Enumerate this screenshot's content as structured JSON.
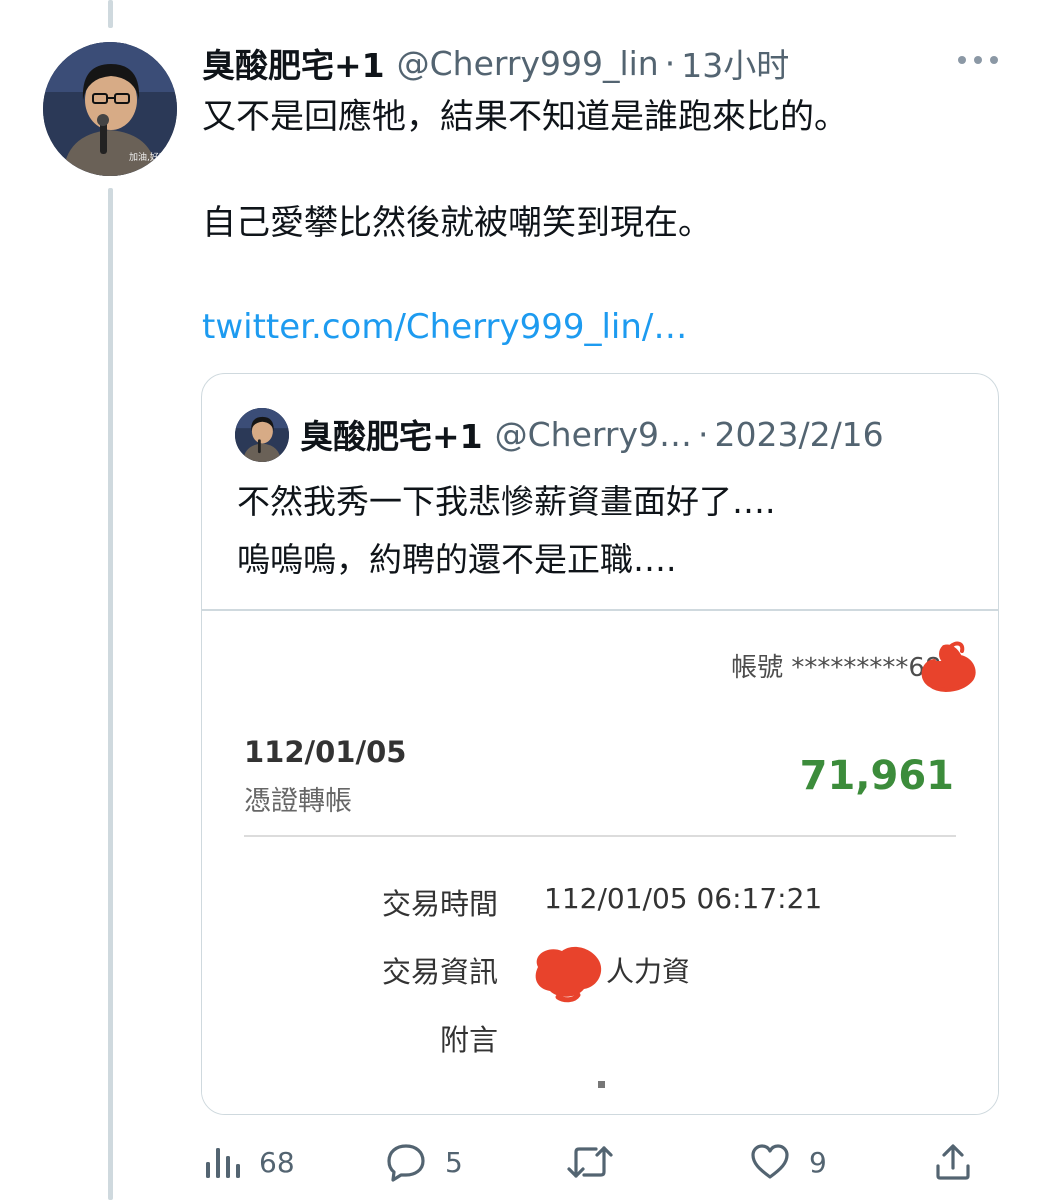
{
  "tweet": {
    "author_name": "臭酸肥宅+1",
    "author_handle": "@Cherry999_lin",
    "separator": "·",
    "time": "13小时",
    "avatar_caption": "加油,好嗎",
    "lines": [
      "又不是回應牠，結果不知道是誰跑來比的。",
      "自己愛攀比然後就被嘲笑到現在。"
    ],
    "link": "twitter.com/Cherry999_lin/…"
  },
  "quoted": {
    "author_name": "臭酸肥宅+1",
    "author_handle": "@Cherry9…",
    "separator": "·",
    "date": "2023/2/16",
    "lines": [
      "不然我秀一下我悲慘薪資畫面好了….",
      "嗚嗚嗚，約聘的還不是正職…."
    ],
    "bank": {
      "account_label": "帳號 *********689",
      "date": "112/01/05",
      "type": "憑證轉帳",
      "amount": "71,961",
      "time_label": "交易時間",
      "time_value": "112/01/05 06:17:21",
      "info_label": "交易資訊",
      "info_value": "人力資",
      "note_label": "附言"
    }
  },
  "actions": {
    "views": "68",
    "replies": "5",
    "retweets": "",
    "likes": "9"
  },
  "colors": {
    "link": "#1d9bf0",
    "amount": "#3c8c3b",
    "scribble": "#e8432c",
    "muted": "#536471"
  }
}
